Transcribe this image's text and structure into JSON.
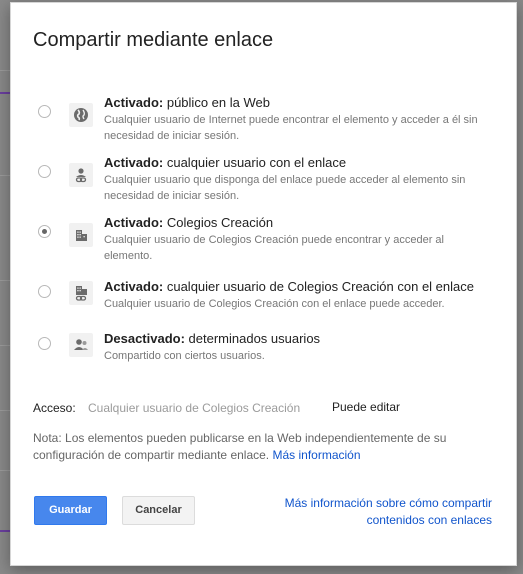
{
  "dialog": {
    "title": "Compartir mediante enlace"
  },
  "options": [
    {
      "bold": "Activado:",
      "rest": " público en la Web",
      "desc": "Cualquier usuario de Internet puede encontrar el elemento y acceder a él sin necesidad de iniciar sesión.",
      "icon": "globe-icon",
      "selected": false
    },
    {
      "bold": "Activado:",
      "rest": " cualquier usuario con el enlace",
      "desc": "Cualquier usuario que disponga del enlace puede acceder al elemento sin necesidad de iniciar sesión.",
      "icon": "person-link-icon",
      "selected": false
    },
    {
      "bold": "Activado:",
      "rest": " Colegios Creación",
      "desc": "Cualquier usuario de Colegios Creación puede encontrar y acceder al elemento.",
      "icon": "building-icon",
      "selected": true
    },
    {
      "bold": "Activado:",
      "rest": " cualquier usuario de Colegios Creación con el enlace",
      "desc": "Cualquier usuario de Colegios Creación con el enlace puede acceder.",
      "icon": "building-link-icon",
      "selected": false
    },
    {
      "bold": "Desactivado:",
      "rest": " determinados usuarios",
      "desc": "Compartido con ciertos usuarios.",
      "icon": "people-icon",
      "selected": false
    }
  ],
  "access": {
    "label": "Acceso:",
    "value": "Cualquier usuario de Colegios Creación",
    "permission": "Puede editar"
  },
  "note": {
    "text": "Nota: Los elementos pueden publicarse en la Web independientemente de su configuración de compartir mediante enlace. ",
    "link": "Más información"
  },
  "buttons": {
    "save": "Guardar",
    "cancel": "Cancelar"
  },
  "help_link": "Más información sobre cómo compartir contenidos con enlaces",
  "colors": {
    "primary": "#4787ed",
    "link": "#1155cc"
  }
}
